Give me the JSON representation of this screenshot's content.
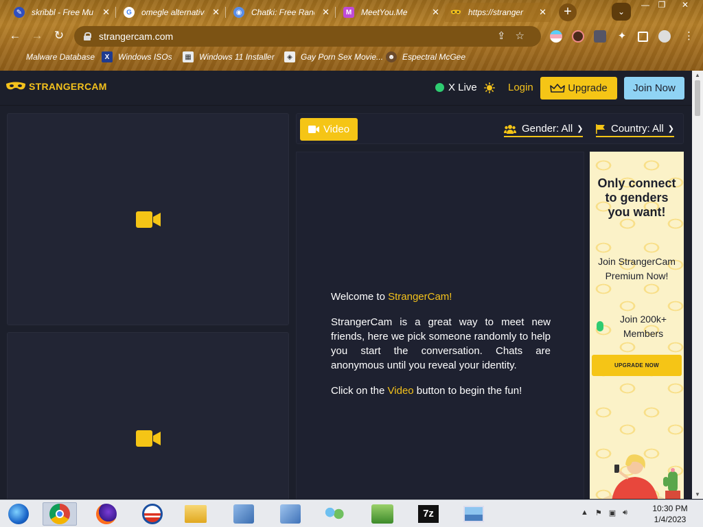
{
  "browser": {
    "tabs": [
      {
        "label": "skribbl - Free Mu",
        "icon": "pencil-icon",
        "color": "#3b5bdb"
      },
      {
        "label": "omegle alternative",
        "icon": "google-icon",
        "color": "#ffffff"
      },
      {
        "label": "Chatki: Free Rand",
        "icon": "chatki-icon",
        "color": "#5a8ee8"
      },
      {
        "label": "MeetYou.Me",
        "icon": "meetyou-icon",
        "color": "#c04bd8"
      },
      {
        "label": "https://stranger",
        "icon": "strangercam-mask-icon",
        "color": "#f4c21c"
      }
    ],
    "url": "strangercam.com",
    "bookmarks": [
      {
        "label": "Malware Database",
        "icon": "malware-icon"
      },
      {
        "label": "Windows ISOs",
        "icon": "x-icon"
      },
      {
        "label": "Windows 11 Installer",
        "icon": "installer-icon"
      },
      {
        "label": "Gay Porn Sex Movie...",
        "icon": "site-icon"
      },
      {
        "label": "Espectral McGee",
        "icon": "espectral-icon"
      }
    ],
    "new_tab": "+",
    "tab_menu": "⌄"
  },
  "site": {
    "logo": "STRANGERCAM",
    "live_label": "X Live",
    "login_label": "Login",
    "upgrade_label": "Upgrade",
    "join_label": "Join Now",
    "video_button": "Video",
    "gender_filter": "Gender: All",
    "country_filter": "Country: All",
    "welcome": {
      "line1_prefix": "Welcome to ",
      "line1_brand": "StrangerCam!",
      "para": "StrangerCam is a great way to meet new friends, here we pick someone randomly to help you start the conversation. Chats are anonymous until you reveal your identity.",
      "line3_prefix": "Click on the ",
      "line3_link": "Video",
      "line3_suffix": " button to begin the fun!"
    },
    "ad": {
      "headline": "Only connect to genders you want!",
      "body": "Join StrangerCam Premium Now!",
      "members": "Join 200k+ Members",
      "cta": "UPGRADE NOW"
    },
    "colors": {
      "accent": "#f5c516",
      "join": "#8fd3f4",
      "bg": "#1c1f2b",
      "live": "#2ecc71"
    }
  },
  "taskbar": {
    "apps": [
      "ie-icon",
      "chrome-icon",
      "firefox-icon",
      "obama-icon",
      "explorer-icon",
      "network-icon",
      "network2-icon",
      "users-icon",
      "disk-icon",
      "7zip-icon",
      "image-icon"
    ],
    "time": "10:30 PM",
    "date": "1/4/2023"
  }
}
